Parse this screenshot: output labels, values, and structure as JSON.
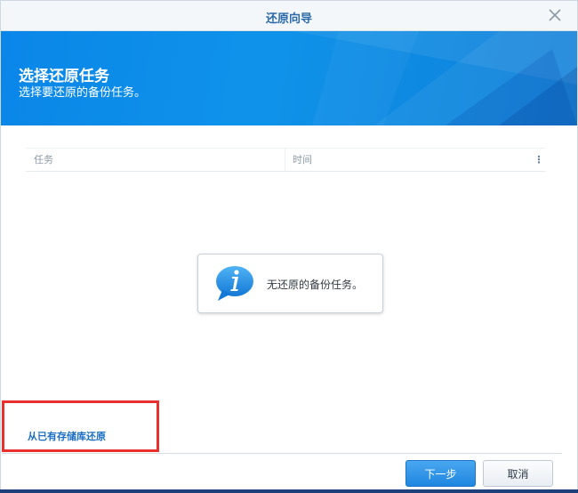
{
  "window": {
    "title": "还原向导",
    "close_icon": "close-icon"
  },
  "banner": {
    "title": "选择还原任务",
    "subtitle": "选择要还原的备份任务。"
  },
  "table": {
    "columns": [
      "任务",
      "时间"
    ],
    "menu_glyph": "⋮"
  },
  "empty_message": "无还原的备份任务。",
  "restore_link": "从已有存储库还原",
  "buttons": {
    "next": "下一步",
    "cancel": "取消"
  },
  "colors": {
    "banner_blue": "#0f93ea",
    "accent": "#1a6fc4",
    "highlight_red": "#e8312f"
  }
}
